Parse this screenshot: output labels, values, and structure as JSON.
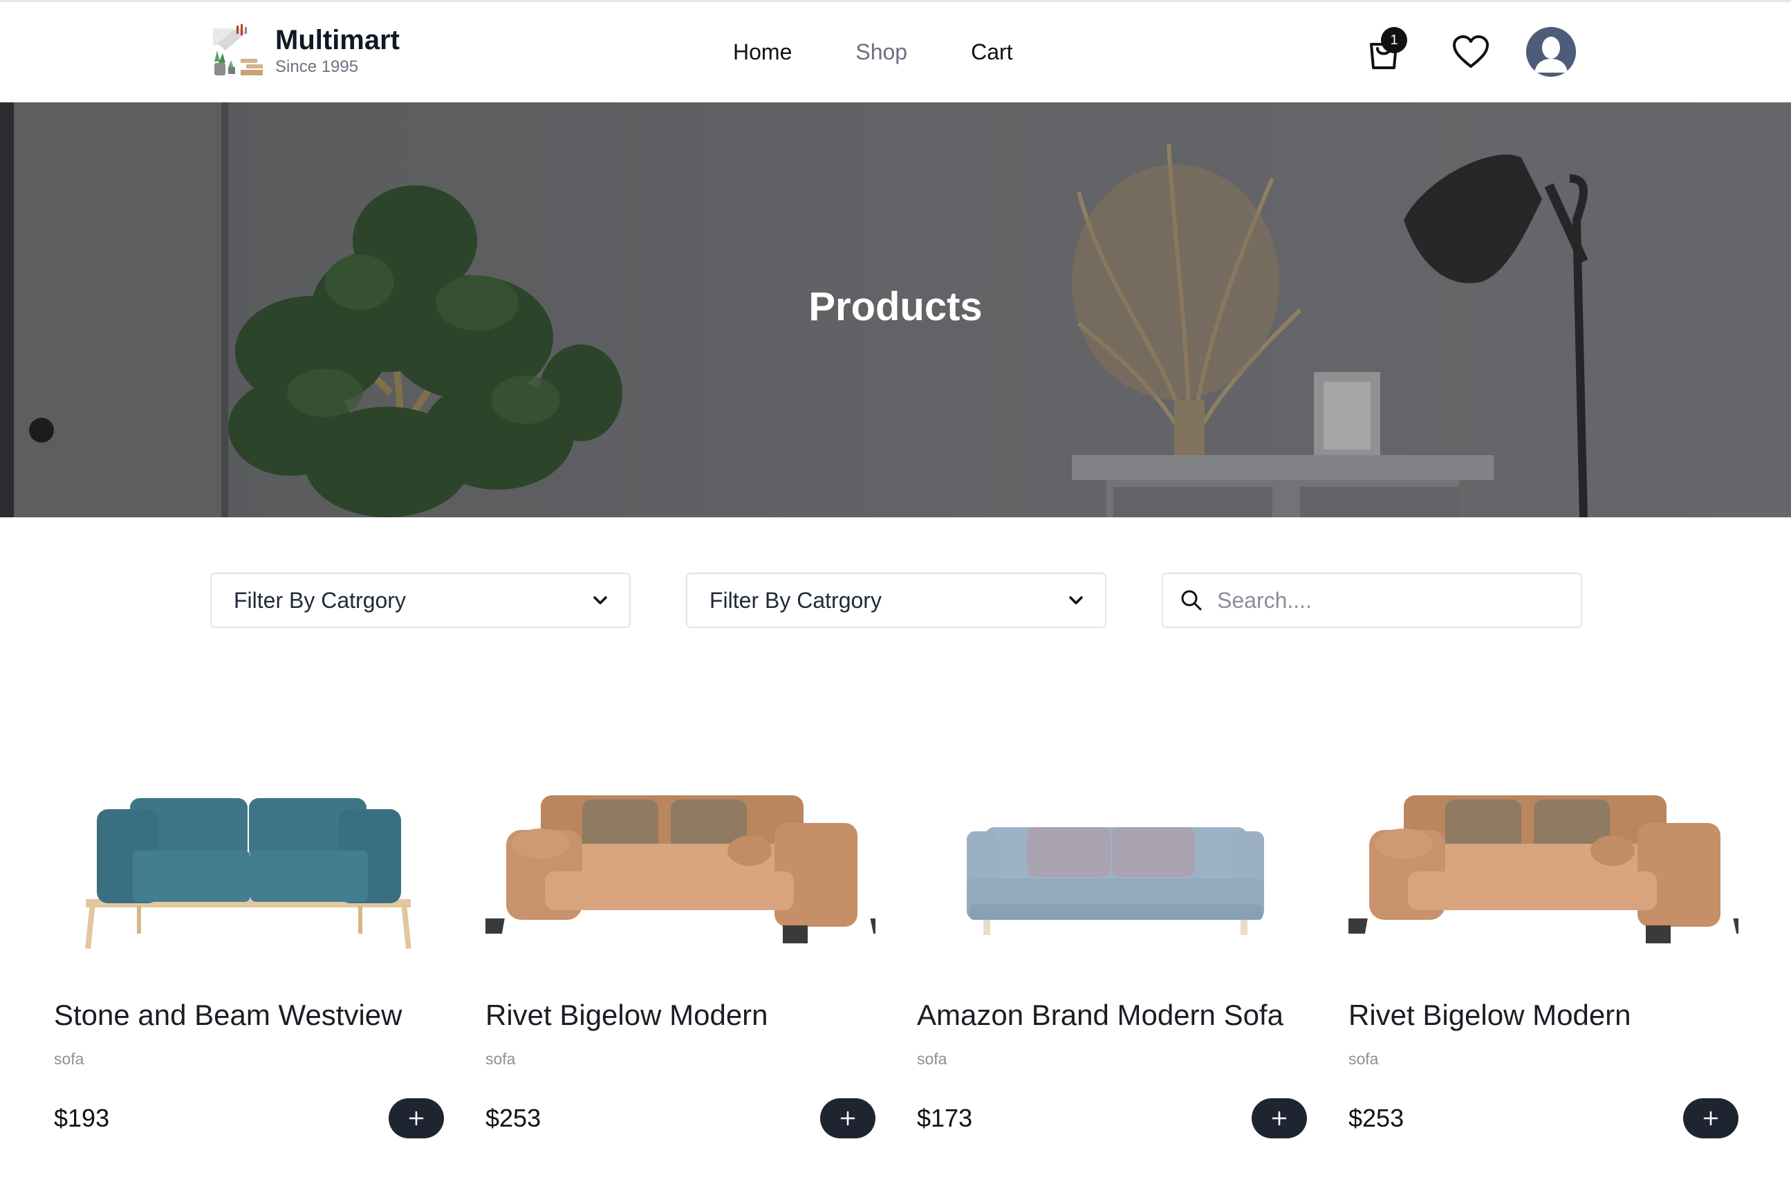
{
  "header": {
    "brand_name": "Multimart",
    "brand_tagline": "Since 1995",
    "nav": [
      {
        "label": "Home",
        "active": false
      },
      {
        "label": "Shop",
        "active": true
      },
      {
        "label": "Cart",
        "active": false
      }
    ],
    "cart_count": "1",
    "icons": [
      "shopping-bag-icon",
      "heart-icon",
      "user-avatar-icon"
    ]
  },
  "hero": {
    "title": "Products"
  },
  "filters": {
    "category_1": "Filter By Catrgory",
    "category_2": "Filter By Catrgory",
    "search_placeholder": "Search...."
  },
  "products": [
    {
      "name": "Stone and Beam Westview",
      "category": "sofa",
      "price": "$193",
      "image": "teal-sofa"
    },
    {
      "name": "Rivet Bigelow Modern",
      "category": "sofa",
      "price": "$253",
      "image": "tan-sofa"
    },
    {
      "name": "Amazon Brand Modern Sofa",
      "category": "sofa",
      "price": "$173",
      "image": "grey-blue-sofa"
    },
    {
      "name": "Rivet Bigelow Modern",
      "category": "sofa",
      "price": "$253",
      "image": "tan-sofa"
    }
  ],
  "colors": {
    "dark": "#1e2430",
    "muted": "#6b7280",
    "teal_sofa": "#3f7b8c",
    "tan_sofa": "#c99a73",
    "grey_sofa": "#9bb0c2"
  }
}
